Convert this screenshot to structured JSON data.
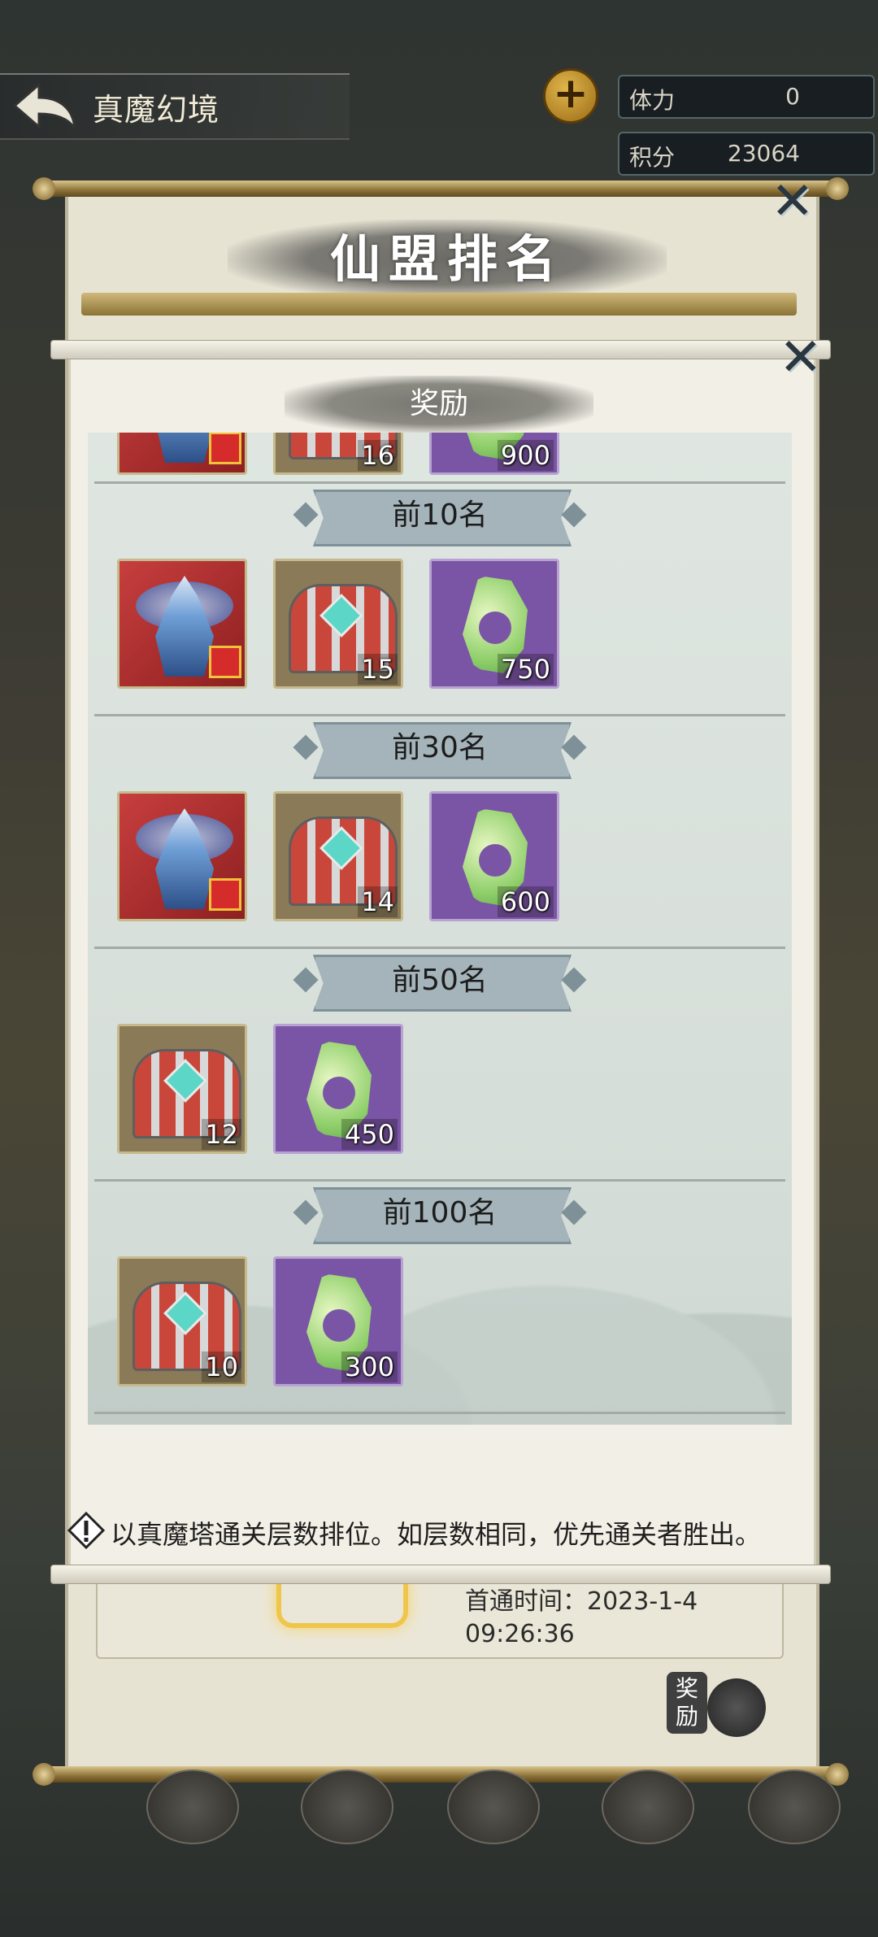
{
  "header": {
    "title": "真魔幻境",
    "back_icon": "back-arrow-icon",
    "stats": [
      {
        "label": "体力",
        "value": "0"
      },
      {
        "label": "积分",
        "value": "23064"
      }
    ]
  },
  "back_panel": {
    "title": "仙盟排名",
    "first_clear_line1": "首通时间：2023-1-4",
    "first_clear_line2": "09:26:36",
    "reward_button_label": "奖励"
  },
  "dialog": {
    "title": "奖励",
    "partial_row_quantities": [
      "16",
      "900"
    ],
    "tiers": [
      {
        "label": "前10名",
        "items": [
          {
            "type": "costume",
            "qty": ""
          },
          {
            "type": "chest",
            "qty": "15"
          },
          {
            "type": "jade",
            "qty": "750"
          }
        ]
      },
      {
        "label": "前30名",
        "items": [
          {
            "type": "costume",
            "qty": ""
          },
          {
            "type": "chest",
            "qty": "14"
          },
          {
            "type": "jade",
            "qty": "600"
          }
        ]
      },
      {
        "label": "前50名",
        "items": [
          {
            "type": "chest",
            "qty": "12"
          },
          {
            "type": "jade",
            "qty": "450"
          }
        ]
      },
      {
        "label": "前100名",
        "items": [
          {
            "type": "chest",
            "qty": "10"
          },
          {
            "type": "jade",
            "qty": "300"
          }
        ]
      }
    ],
    "footer_note": "以真魔塔通关层数排位。如层数相同，优先通关者胜出。"
  },
  "colors": {
    "accent": "#a4b4ba",
    "jade_bg": "#7b55a5",
    "costume_bg": "#c83e3e"
  }
}
